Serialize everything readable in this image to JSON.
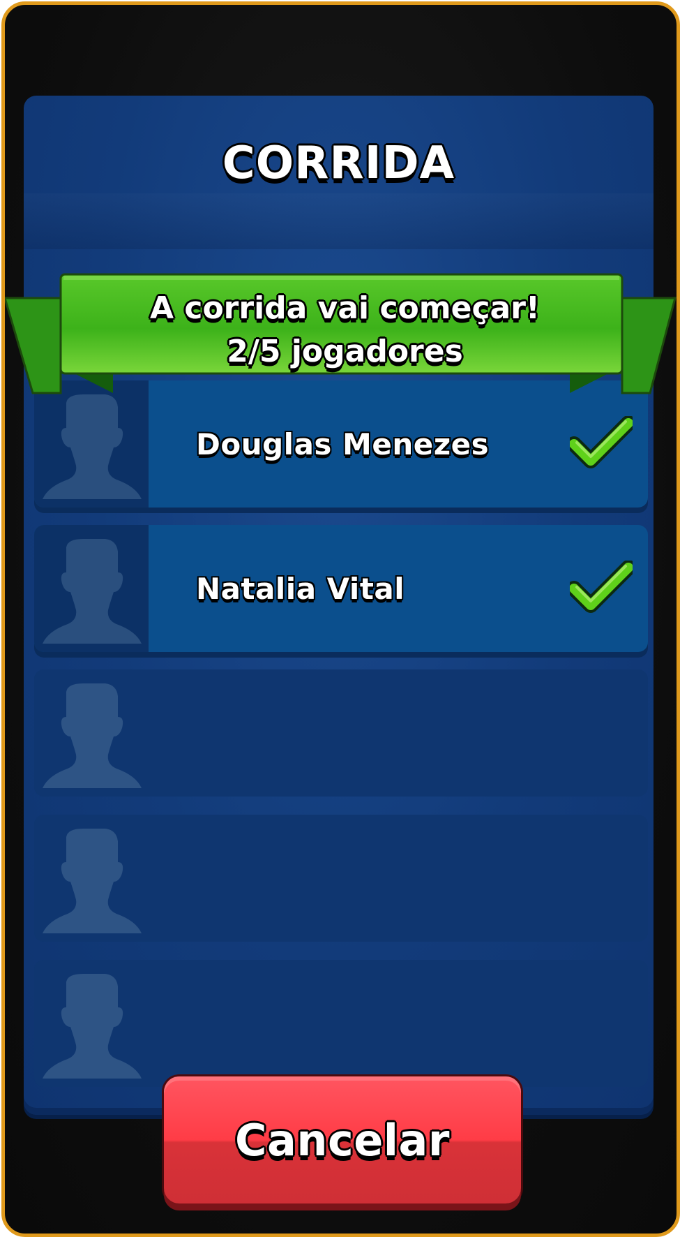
{
  "screen": {
    "title": "CORRIDA",
    "banner": {
      "line1": "A corrida vai começar!",
      "line2": "2/5 jogadores"
    },
    "players": [
      {
        "name": "Douglas Menezes",
        "ready": true,
        "icon": "check-icon"
      },
      {
        "name": "Natalia Vital",
        "ready": true,
        "icon": "check-icon"
      },
      {
        "name": "",
        "ready": false
      },
      {
        "name": "",
        "ready": false
      },
      {
        "name": "",
        "ready": false
      }
    ],
    "cancel_label": "Cancelar"
  },
  "colors": {
    "frame_border": "#e09a1c",
    "panel": "#123b7a",
    "ribbon_green": "#48b51f",
    "cancel_red": "#ff3c46",
    "check_green": "#5fd11a"
  }
}
